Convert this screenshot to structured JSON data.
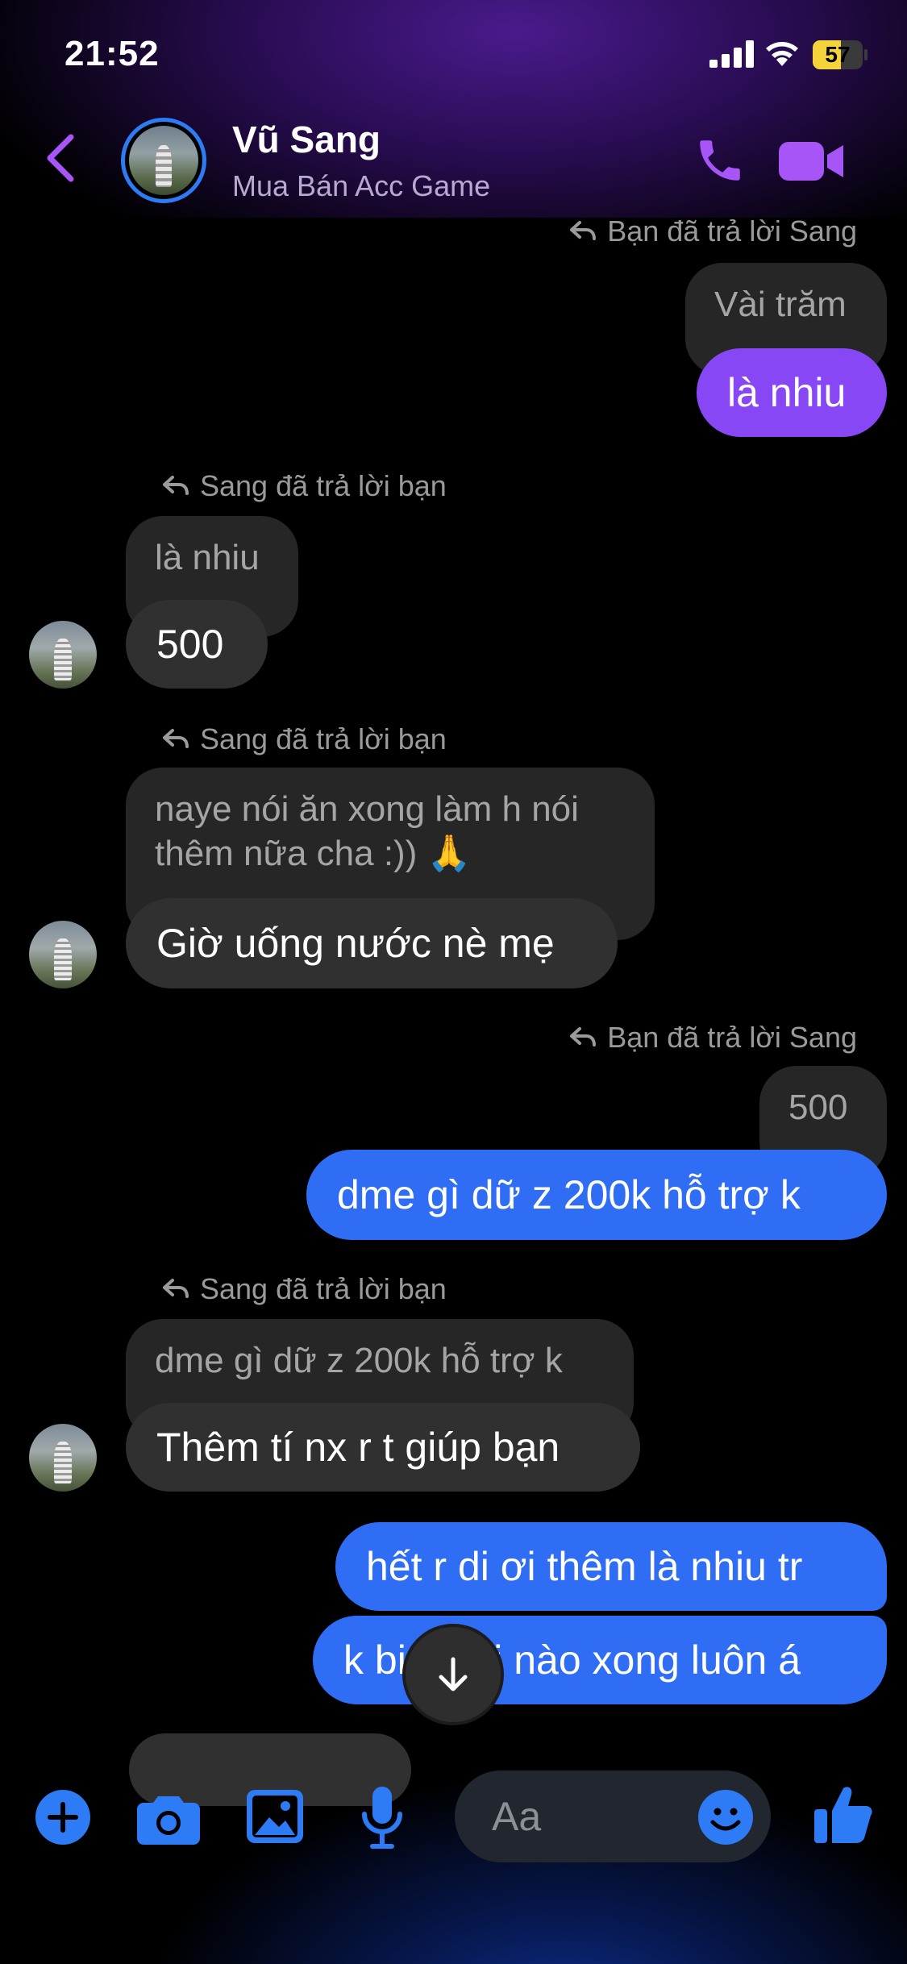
{
  "status_bar": {
    "time": "21:52",
    "battery": "57",
    "battery_level_percent": 57
  },
  "header": {
    "name": "Vũ Sang",
    "subtitle": "Mua Bán Acc Game"
  },
  "messages": {
    "reply1_label": "Bạn đã trả lời Sang",
    "reply1_quote": "Vài trăm",
    "reply1_text": "là nhiu",
    "reply2_label": "Sang đã trả lời bạn",
    "reply2_quote": "là nhiu",
    "reply2_text": "500",
    "reply3_label": "Sang đã trả lời bạn",
    "reply3_quote_line1": "naye nói ăn xong làm h nói",
    "reply3_quote_line2": "thêm nữa cha :)) 🙏",
    "reply3_text": "Giờ uống nước nè mẹ",
    "reply4_label": "Bạn đã trả lời Sang",
    "reply4_quote": "500",
    "reply4_text": "dme gì dữ z 200k hỗ trợ k",
    "reply5_label": "Sang đã trả lời bạn",
    "reply5_quote": "dme gì dữ z 200k hỗ trợ k",
    "reply5_text": "Thêm tí nx r t giúp bạn",
    "out1_text": "hết r di ơi thêm là nhiu tr",
    "out2_text": "k biết khi nào xong luôn á"
  },
  "composer": {
    "placeholder": "Aa"
  },
  "icons": {
    "back": "chevron-left-icon",
    "call": "phone-icon",
    "video": "video-camera-icon",
    "add": "plus-circle-icon",
    "camera": "camera-icon",
    "gallery": "image-icon",
    "mic": "microphone-icon",
    "emoji": "smiley-icon",
    "like": "thumbs-up-icon",
    "scroll_down": "arrow-down-icon"
  },
  "colors": {
    "accent_purple": "#8847f5",
    "accent_blue": "#2f6df5",
    "icon_purple": "#a855f7",
    "icon_blue": "#2d7bf5",
    "incoming_bubble": "#303030"
  }
}
